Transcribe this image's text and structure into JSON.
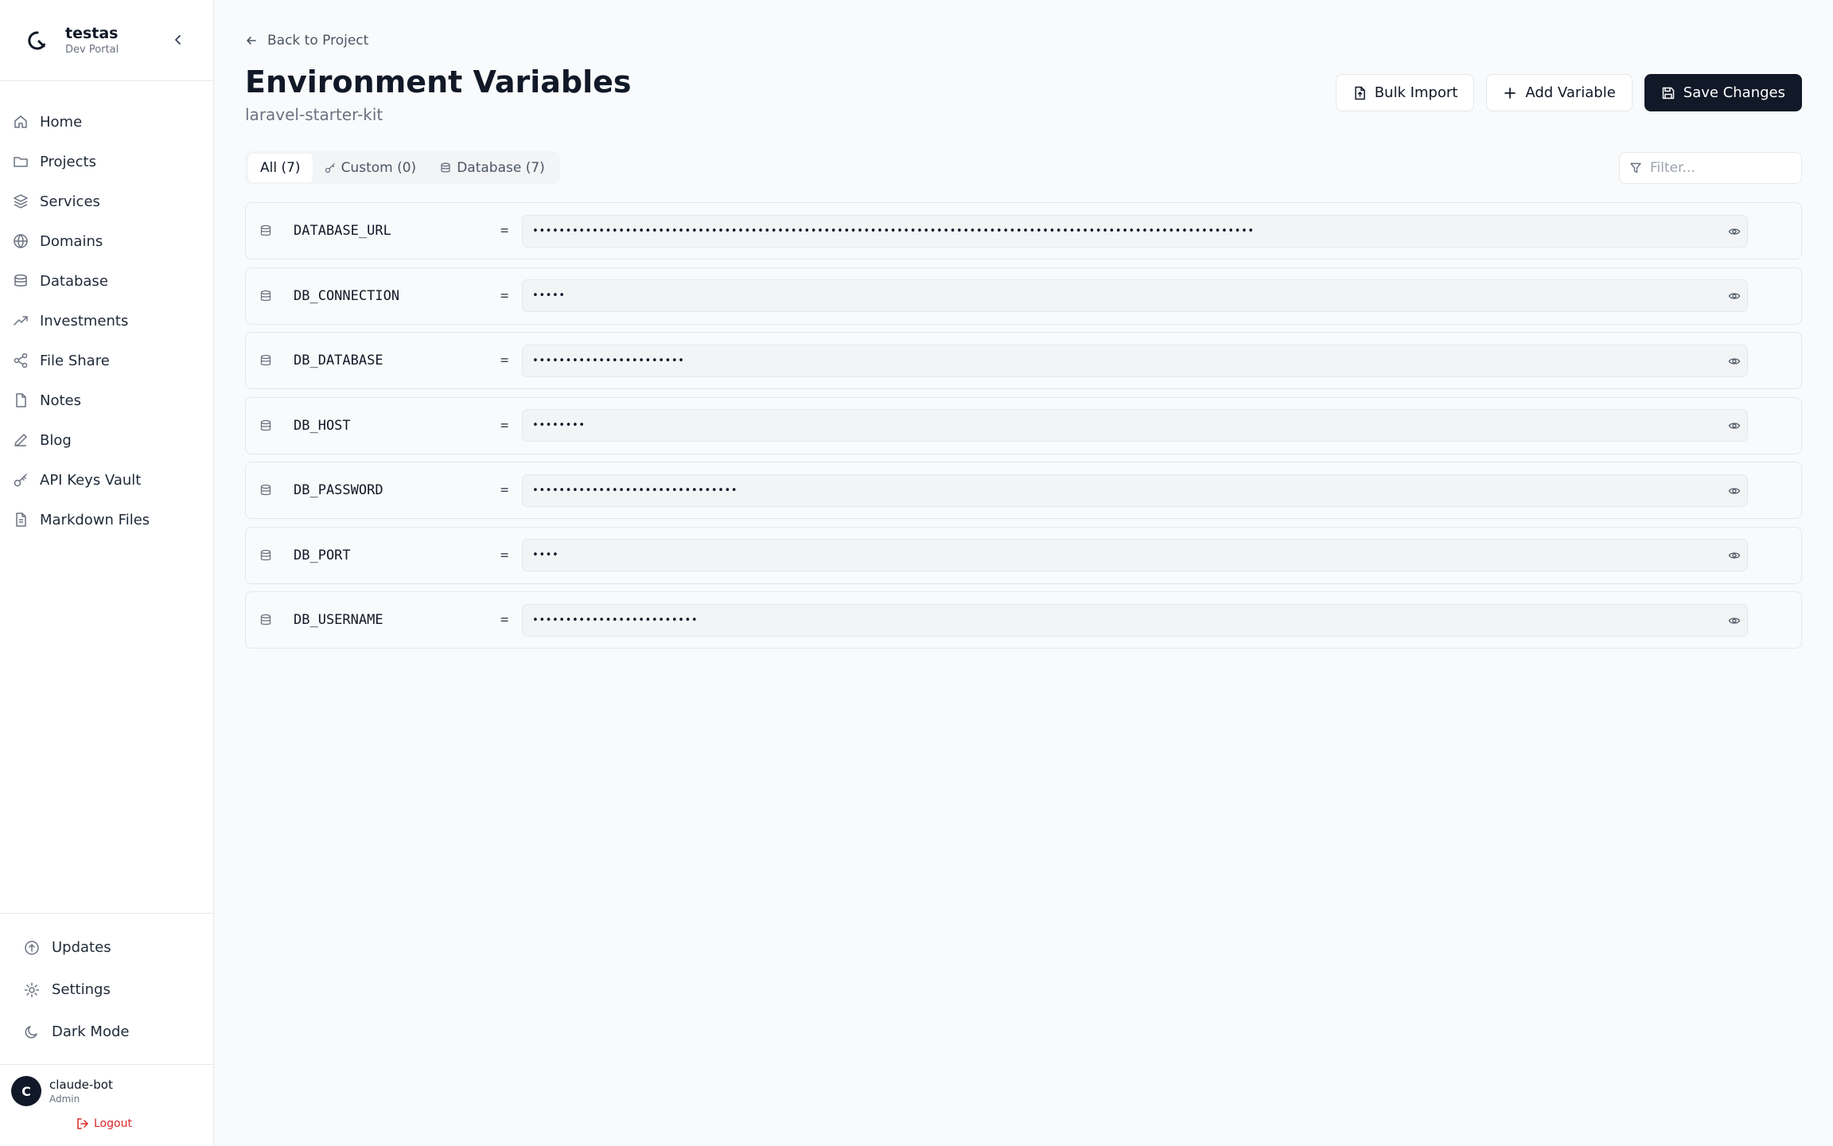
{
  "brand": {
    "name": "testas",
    "subtitle": "Dev Portal"
  },
  "nav": [
    {
      "label": "Home",
      "icon": "home-icon"
    },
    {
      "label": "Projects",
      "icon": "folder-icon"
    },
    {
      "label": "Services",
      "icon": "layers-icon"
    },
    {
      "label": "Domains",
      "icon": "globe-icon"
    },
    {
      "label": "Database",
      "icon": "database-icon"
    },
    {
      "label": "Investments",
      "icon": "trending-up-icon"
    },
    {
      "label": "File Share",
      "icon": "share-icon"
    },
    {
      "label": "Notes",
      "icon": "file-icon"
    },
    {
      "label": "Blog",
      "icon": "pen-icon"
    },
    {
      "label": "API Keys Vault",
      "icon": "key-icon"
    },
    {
      "label": "Markdown Files",
      "icon": "file-text-icon"
    }
  ],
  "bottom_nav": [
    {
      "label": "Updates",
      "icon": "upload-circle-icon"
    },
    {
      "label": "Settings",
      "icon": "gear-icon"
    },
    {
      "label": "Dark Mode",
      "icon": "moon-icon"
    }
  ],
  "user": {
    "initial": "C",
    "name": "claude-bot",
    "role": "Admin",
    "logout": "Logout"
  },
  "page": {
    "back_label": "Back to Project",
    "title": "Environment Variables",
    "subtitle": "laravel-starter-kit"
  },
  "actions": {
    "bulk_import": "Bulk Import",
    "add_variable": "Add Variable",
    "save_changes": "Save Changes"
  },
  "tabs": [
    {
      "label": "All (7)",
      "active": true
    },
    {
      "label": "Custom (0)",
      "active": false
    },
    {
      "label": "Database (7)",
      "active": false
    }
  ],
  "filter": {
    "placeholder": "Filter..."
  },
  "variables": [
    {
      "key": "DATABASE_URL",
      "masked": "•••••••••••••••••••••••••••••••••••••••••••••••••••••••••••••••••••••••••••••••••••••••••••••••••••••••••••••"
    },
    {
      "key": "DB_CONNECTION",
      "masked": "•••••"
    },
    {
      "key": "DB_DATABASE",
      "masked": "•••••••••••••••••••••••"
    },
    {
      "key": "DB_HOST",
      "masked": "••••••••"
    },
    {
      "key": "DB_PASSWORD",
      "masked": "•••••••••••••••••••••••••••••••"
    },
    {
      "key": "DB_PORT",
      "masked": "••••"
    },
    {
      "key": "DB_USERNAME",
      "masked": "•••••••••••••••••••••••••"
    }
  ],
  "colors": {
    "accent": "#111827",
    "danger": "#dc2626",
    "background": "#f9fafb"
  }
}
